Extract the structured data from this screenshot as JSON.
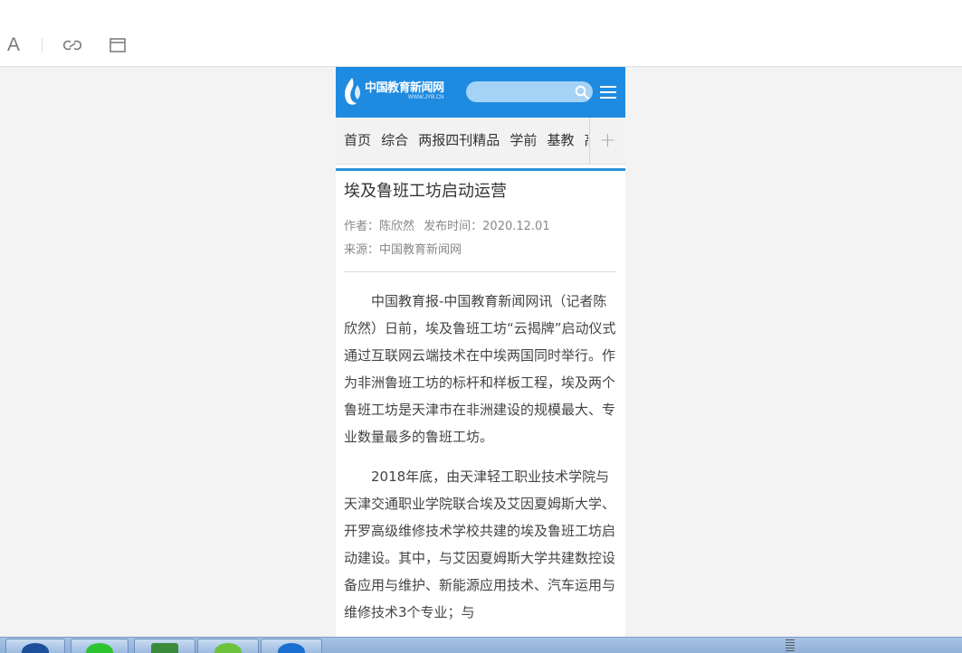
{
  "toolbar": {
    "font_label": "A",
    "link_icon": "link-icon",
    "window_icon": "window-icon"
  },
  "site": {
    "title": "中国教育新闻网",
    "subtitle": "WWW.JYB.CN",
    "brand_color": "#1f8be0",
    "search_placeholder": ""
  },
  "nav": {
    "items": [
      "首页",
      "综合",
      "两报四刊精品",
      "学前",
      "基教",
      "高"
    ],
    "more_label": "+"
  },
  "article": {
    "title": "埃及鲁班工坊启动运营",
    "author": "作者：陈欣然",
    "publish_time": "发布时间：2020.12.01",
    "source": "来源：中国教育新闻网",
    "paragraphs": [
      "中国教育报-中国教育新闻网讯（记者陈欣然）日前，埃及鲁班工坊“云揭牌”启动仪式通过互联网云端技术在中埃两国同时举行。作为非洲鲁班工坊的标杆和样板工程，埃及两个鲁班工坊是天津市在非洲建设的规模最大、专业数量最多的鲁班工坊。",
      "2018年底，由天津轻工职业技术学院与天津交通职业学院联合埃及艾因夏姆斯大学、开罗高级维修技术学校共建的埃及鲁班工坊启动建设。其中，与艾因夏姆斯大学共建数控设备应用与维护、新能源应用技术、汽车运用与维修技术3个专业；与"
    ]
  },
  "taskbar": {
    "apps": [
      "word-icon",
      "wechat-icon",
      "excel-icon",
      "browser-icon",
      "app-icon"
    ]
  }
}
